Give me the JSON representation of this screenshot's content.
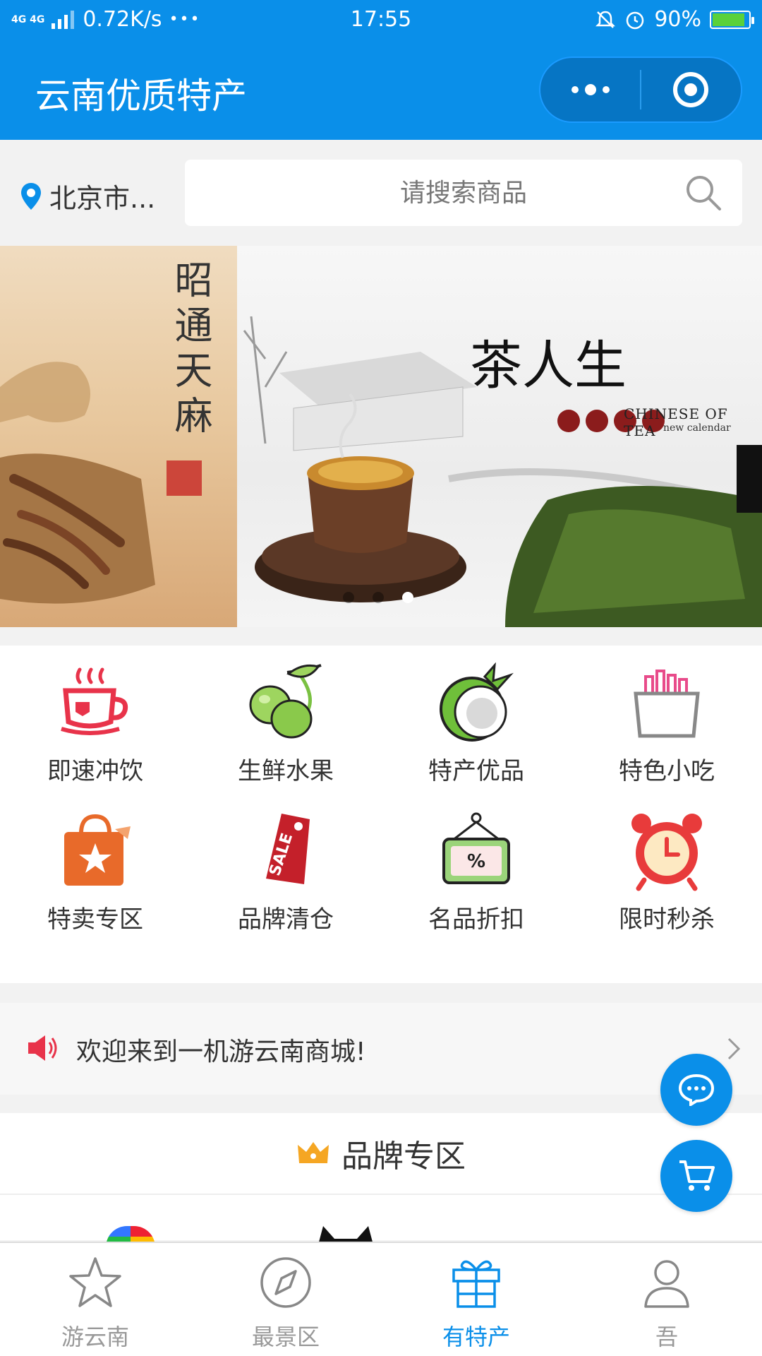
{
  "status_bar": {
    "network_type": "4G 4G",
    "speed": "0.72K/s",
    "more": "•••",
    "time": "17:55",
    "battery": "90%",
    "battery_level": 0.9
  },
  "nav": {
    "title": "云南优质特产"
  },
  "search": {
    "location": "北京市...",
    "placeholder": "请搜索商品"
  },
  "banner": {
    "left_slide_text": "昭通天麻",
    "main_title": "茶人生",
    "main_subtitle": "CHINESE OF TEA",
    "main_subtitle2": "new calendar",
    "dots_count": 3,
    "active_dot": 3
  },
  "categories": [
    {
      "label": "即速冲饮",
      "icon": "tea-cup-icon"
    },
    {
      "label": "生鲜水果",
      "icon": "olive-fruit-icon"
    },
    {
      "label": "特产优品",
      "icon": "coconut-icon"
    },
    {
      "label": "特色小吃",
      "icon": "snack-box-icon"
    },
    {
      "label": "特卖专区",
      "icon": "shopping-bag-star-icon"
    },
    {
      "label": "品牌清仓",
      "icon": "sale-tag-icon"
    },
    {
      "label": "名品折扣",
      "icon": "discount-sign-icon"
    },
    {
      "label": "限时秒杀",
      "icon": "alarm-clock-icon"
    }
  ],
  "notice": {
    "text": "欢迎来到一机游云南商城!"
  },
  "brand_section": {
    "title": "品牌专区"
  },
  "tabs": [
    {
      "label": "游云南",
      "icon": "star-icon",
      "active": false
    },
    {
      "label": "最景区",
      "icon": "compass-icon",
      "active": false
    },
    {
      "label": "有特产",
      "icon": "gift-icon",
      "active": true
    },
    {
      "label": "吾",
      "icon": "user-icon",
      "active": false
    }
  ],
  "colors": {
    "primary": "#0a8fe9",
    "background": "#f2f2f2",
    "tab_inactive": "#999999",
    "speaker_red": "#e8334a"
  }
}
